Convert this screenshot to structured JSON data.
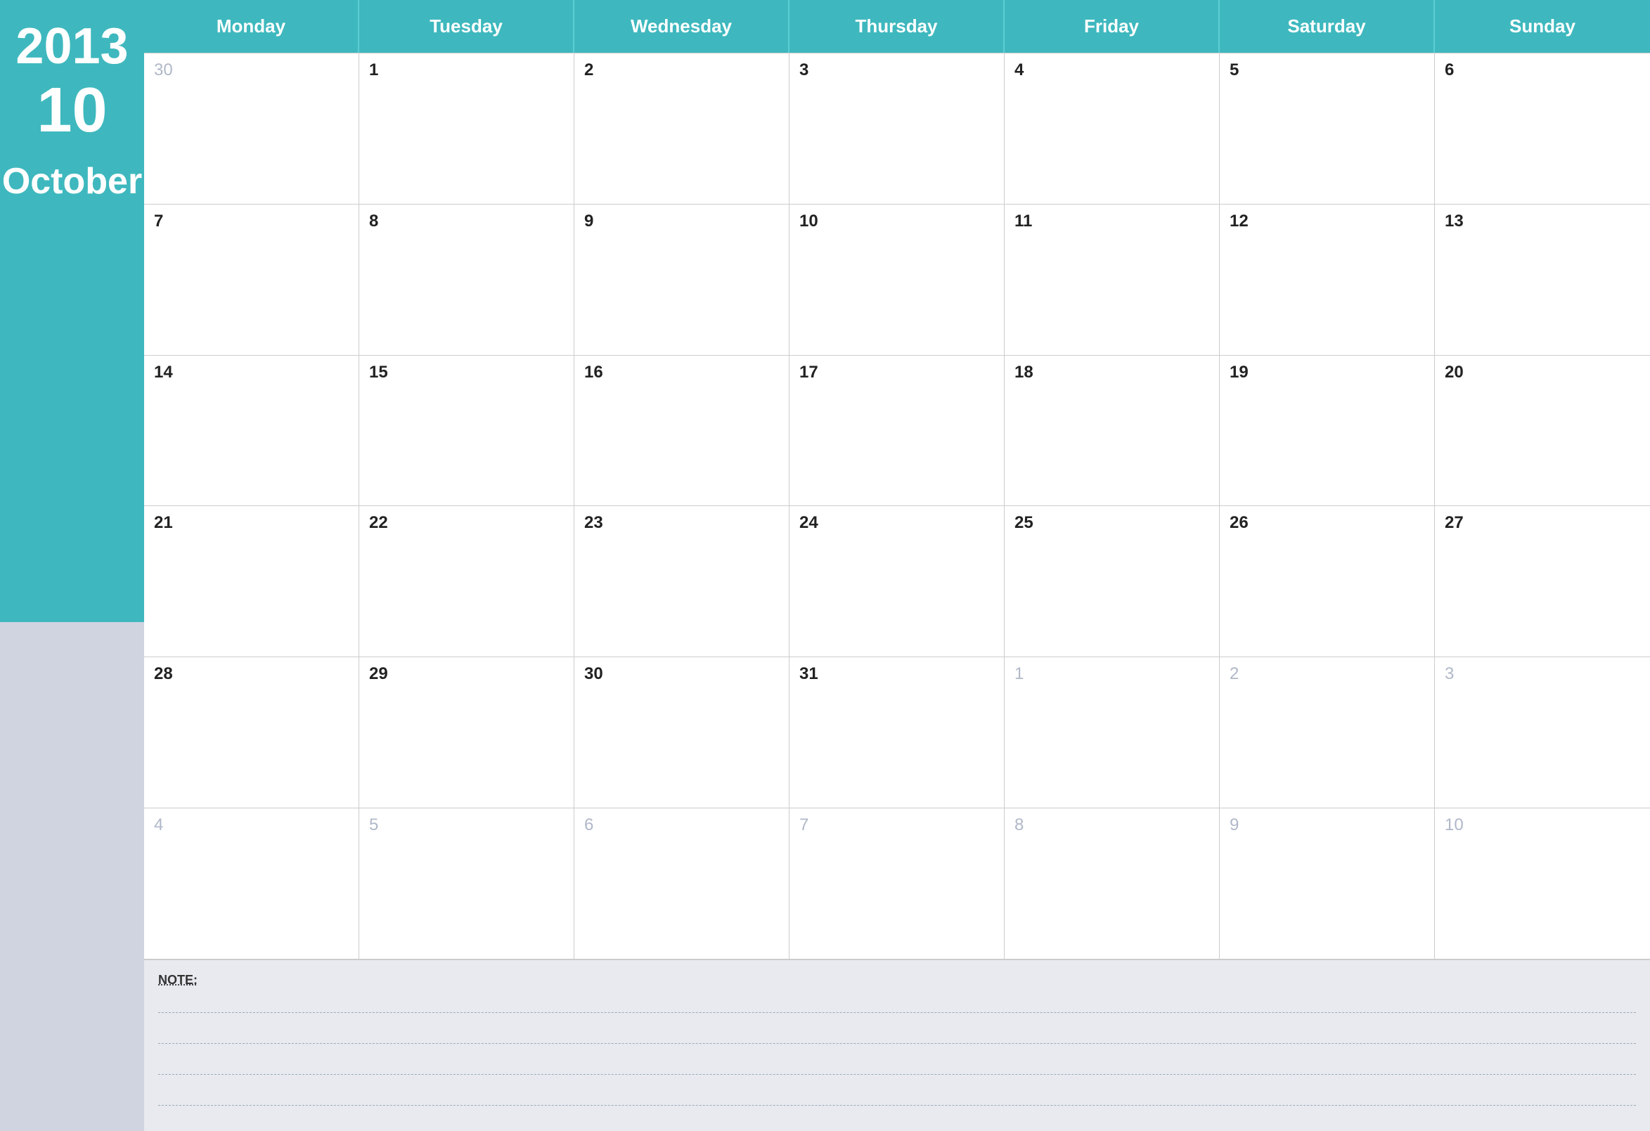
{
  "sidebar": {
    "year": "2013",
    "week_number": "10",
    "month": "October"
  },
  "header": {
    "days": [
      "Monday",
      "Tuesday",
      "Wednesday",
      "Thursday",
      "Friday",
      "Saturday",
      "Sunday"
    ]
  },
  "calendar": {
    "weeks": [
      [
        {
          "day": "30",
          "outside": true
        },
        {
          "day": "1",
          "outside": false
        },
        {
          "day": "2",
          "outside": false
        },
        {
          "day": "3",
          "outside": false
        },
        {
          "day": "4",
          "outside": false
        },
        {
          "day": "5",
          "outside": false
        },
        {
          "day": "6",
          "outside": false
        }
      ],
      [
        {
          "day": "7",
          "outside": false
        },
        {
          "day": "8",
          "outside": false
        },
        {
          "day": "9",
          "outside": false
        },
        {
          "day": "10",
          "outside": false
        },
        {
          "day": "11",
          "outside": false
        },
        {
          "day": "12",
          "outside": false
        },
        {
          "day": "13",
          "outside": false
        }
      ],
      [
        {
          "day": "14",
          "outside": false
        },
        {
          "day": "15",
          "outside": false
        },
        {
          "day": "16",
          "outside": false
        },
        {
          "day": "17",
          "outside": false
        },
        {
          "day": "18",
          "outside": false
        },
        {
          "day": "19",
          "outside": false
        },
        {
          "day": "20",
          "outside": false
        }
      ],
      [
        {
          "day": "21",
          "outside": false
        },
        {
          "day": "22",
          "outside": false
        },
        {
          "day": "23",
          "outside": false
        },
        {
          "day": "24",
          "outside": false
        },
        {
          "day": "25",
          "outside": false
        },
        {
          "day": "26",
          "outside": false
        },
        {
          "day": "27",
          "outside": false
        }
      ],
      [
        {
          "day": "28",
          "outside": false
        },
        {
          "day": "29",
          "outside": false
        },
        {
          "day": "30",
          "outside": false
        },
        {
          "day": "31",
          "outside": false
        },
        {
          "day": "1",
          "outside": true
        },
        {
          "day": "2",
          "outside": true
        },
        {
          "day": "3",
          "outside": true
        }
      ],
      [
        {
          "day": "4",
          "outside": true
        },
        {
          "day": "5",
          "outside": true
        },
        {
          "day": "6",
          "outside": true
        },
        {
          "day": "7",
          "outside": true
        },
        {
          "day": "8",
          "outside": true
        },
        {
          "day": "9",
          "outside": true
        },
        {
          "day": "10",
          "outside": true
        }
      ]
    ]
  },
  "notes": {
    "label": "NOTE:",
    "lines": [
      "",
      "",
      "",
      ""
    ]
  }
}
